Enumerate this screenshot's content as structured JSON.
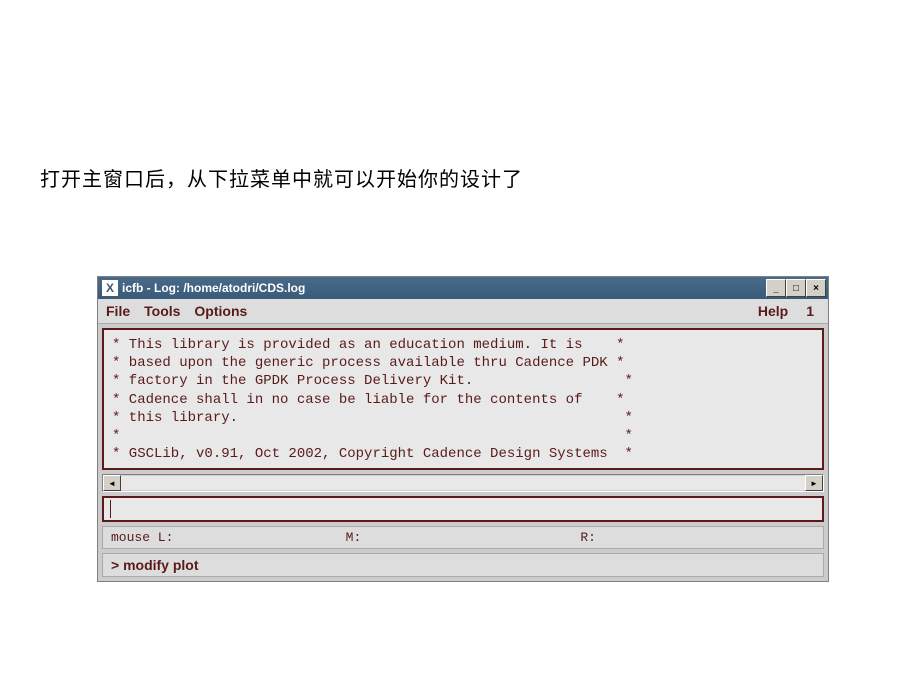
{
  "intro": "打开主窗口后，从下拉菜单中就可以开始你的设计了",
  "window": {
    "title_icon": "X",
    "title": "icfb - Log: /home/atodri/CDS.log",
    "minimize": "_",
    "maximize": "□",
    "close": "×"
  },
  "menu": {
    "file": "File",
    "tools": "Tools",
    "options": "Options",
    "help": "Help",
    "number": "1"
  },
  "log_lines": [
    "* This library is provided as an education medium. It is    *",
    "* based upon the generic process available thru Cadence PDK *",
    "* factory in the GPDK Process Delivery Kit.                  *",
    "* Cadence shall in no case be liable for the contents of    *",
    "* this library.                                              *",
    "*                                                            *",
    "* GSCLib, v0.91, Oct 2002, Copyright Cadence Design Systems  *"
  ],
  "scroll": {
    "left": "◄",
    "right": "►"
  },
  "mouse": {
    "l": "mouse L:",
    "m": "M:",
    "r": "R:"
  },
  "status": "> modify plot"
}
